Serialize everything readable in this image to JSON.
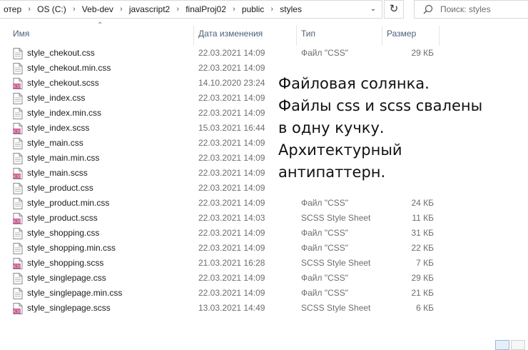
{
  "breadcrumb": {
    "items": [
      "отер",
      "OS (C:)",
      "Veb-dev",
      "javascript2",
      "finalProj02",
      "public",
      "styles"
    ],
    "separator": "›"
  },
  "refresh_icon": "refresh-icon",
  "search": {
    "placeholder": "Поиск: styles"
  },
  "columns": {
    "name": "Имя",
    "date": "Дата изменения",
    "type": "Тип",
    "size": "Размер"
  },
  "files": [
    {
      "name": "style_chekout.css",
      "date": "22.03.2021 14:09",
      "type": "Файл \"CSS\"",
      "size": "29 КБ",
      "kind": "css"
    },
    {
      "name": "style_chekout.min.css",
      "date": "22.03.2021 14:09",
      "type": "",
      "size": "",
      "kind": "css"
    },
    {
      "name": "style_chekout.scss",
      "date": "14.10.2020 23:24",
      "type": "",
      "size": "",
      "kind": "scss"
    },
    {
      "name": "style_index.css",
      "date": "22.03.2021 14:09",
      "type": "",
      "size": "",
      "kind": "css"
    },
    {
      "name": "style_index.min.css",
      "date": "22.03.2021 14:09",
      "type": "",
      "size": "",
      "kind": "css"
    },
    {
      "name": "style_index.scss",
      "date": "15.03.2021 16:44",
      "type": "",
      "size": "",
      "kind": "scss"
    },
    {
      "name": "style_main.css",
      "date": "22.03.2021 14:09",
      "type": "",
      "size": "",
      "kind": "css"
    },
    {
      "name": "style_main.min.css",
      "date": "22.03.2021 14:09",
      "type": "",
      "size": "",
      "kind": "css"
    },
    {
      "name": "style_main.scss",
      "date": "22.03.2021 14:09",
      "type": "",
      "size": "",
      "kind": "scss"
    },
    {
      "name": "style_product.css",
      "date": "22.03.2021 14:09",
      "type": "",
      "size": "",
      "kind": "css"
    },
    {
      "name": "style_product.min.css",
      "date": "22.03.2021 14:09",
      "type": "Файл \"CSS\"",
      "size": "24 КБ",
      "kind": "css"
    },
    {
      "name": "style_product.scss",
      "date": "22.03.2021 14:03",
      "type": "SCSS Style Sheet",
      "size": "11 КБ",
      "kind": "scss"
    },
    {
      "name": "style_shopping.css",
      "date": "22.03.2021 14:09",
      "type": "Файл \"CSS\"",
      "size": "31 КБ",
      "kind": "css"
    },
    {
      "name": "style_shopping.min.css",
      "date": "22.03.2021 14:09",
      "type": "Файл \"CSS\"",
      "size": "22 КБ",
      "kind": "css"
    },
    {
      "name": "style_shopping.scss",
      "date": "21.03.2021 16:28",
      "type": "SCSS Style Sheet",
      "size": "7 КБ",
      "kind": "scss"
    },
    {
      "name": "style_singlepage.css",
      "date": "22.03.2021 14:09",
      "type": "Файл \"CSS\"",
      "size": "29 КБ",
      "kind": "css"
    },
    {
      "name": "style_singlepage.min.css",
      "date": "22.03.2021 14:09",
      "type": "Файл \"CSS\"",
      "size": "21 КБ",
      "kind": "css"
    },
    {
      "name": "style_singlepage.scss",
      "date": "13.03.2021 14:49",
      "type": "SCSS Style Sheet",
      "size": "6 КБ",
      "kind": "scss"
    }
  ],
  "note": {
    "lines": [
      "Файловая солянка.",
      "Файлы css и scss свалены",
      "в одну кучку.",
      "Архитектурный",
      "антипаттерн."
    ]
  },
  "colors": {
    "header_text": "#4c607a",
    "secondary_text": "#6d6d6d",
    "scss_icon": "#c6538c"
  }
}
